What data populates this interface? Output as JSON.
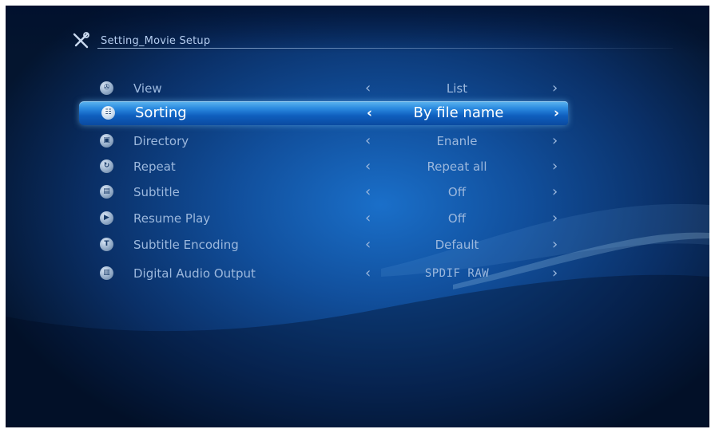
{
  "header": {
    "title": "Setting_Movie Setup",
    "icon": "tools-icon"
  },
  "menu": [
    {
      "icon": "view-icon",
      "glyph": "✇",
      "label": "View",
      "value": "List",
      "selected": false
    },
    {
      "icon": "sorting-icon",
      "glyph": "☷",
      "label": "Sorting",
      "value": "By file name",
      "selected": true
    },
    {
      "icon": "directory-icon",
      "glyph": "▣",
      "label": "Directory",
      "value": "Enanle",
      "selected": false
    },
    {
      "icon": "repeat-icon",
      "glyph": "↻",
      "label": "Repeat",
      "value": "Repeat all",
      "selected": false
    },
    {
      "icon": "subtitle-icon",
      "glyph": "▤",
      "label": "Subtitle",
      "value": "Off",
      "selected": false
    },
    {
      "icon": "resume-play-icon",
      "glyph": "▶",
      "label": "Resume Play",
      "value": "Off",
      "selected": false
    },
    {
      "icon": "subtitle-encoding-icon",
      "glyph": "T",
      "label": "Subtitle Encoding",
      "value": "Default",
      "selected": false
    },
    {
      "icon": "digital-audio-icon",
      "glyph": "▥",
      "label": "Digital Audio Output",
      "value": "SPDIF RAW",
      "selected": false
    }
  ],
  "arrows": {
    "left": "‹",
    "right": "›"
  },
  "colors": {
    "accent": "#2a8ae0",
    "text": "#9cb8dd",
    "background": "#114f9c"
  }
}
